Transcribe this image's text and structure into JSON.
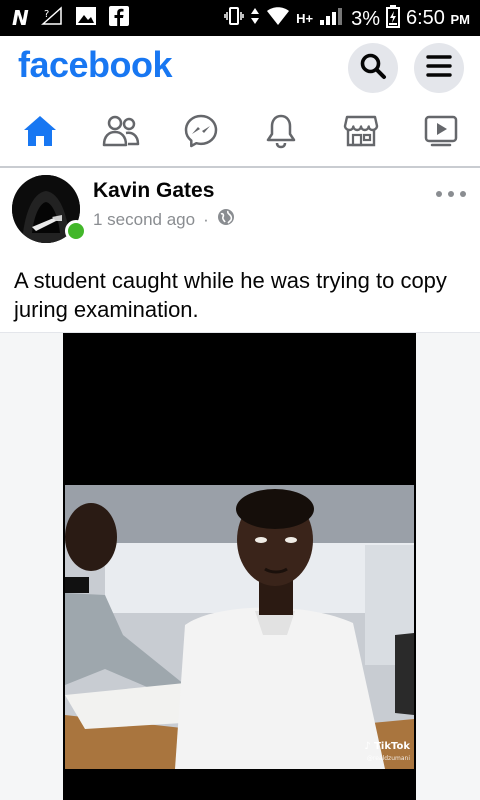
{
  "status_bar": {
    "battery": "3%",
    "time": "6:50",
    "ampm": "PM",
    "network": "H+",
    "icons": [
      "n-notification-icon",
      "no-signal-icon",
      "image-icon",
      "facebook-icon",
      "vibrate-icon",
      "data-arrows-icon",
      "wifi-icon",
      "signal-icon",
      "battery-icon"
    ]
  },
  "header": {
    "logo": "facebook",
    "brand_color": "#1877f2",
    "buttons": [
      "search-icon",
      "menu-icon"
    ]
  },
  "nav": {
    "tabs": [
      {
        "name": "home",
        "icon": "home-icon",
        "active": true
      },
      {
        "name": "friends",
        "icon": "friends-icon",
        "active": false
      },
      {
        "name": "messenger",
        "icon": "messenger-icon",
        "active": false
      },
      {
        "name": "notifications",
        "icon": "bell-icon",
        "active": false
      },
      {
        "name": "marketplace",
        "icon": "store-icon",
        "active": false
      },
      {
        "name": "watch",
        "icon": "video-icon",
        "active": false
      }
    ]
  },
  "post": {
    "author": "Kavin Gates",
    "time": "1 second ago",
    "separator": "·",
    "privacy_icon": "globe-icon",
    "online": true,
    "text": "A student caught while he was trying to copy juring examination.",
    "media": {
      "watermark": "TikTok",
      "watermark_handle": "@realdzumani"
    }
  }
}
